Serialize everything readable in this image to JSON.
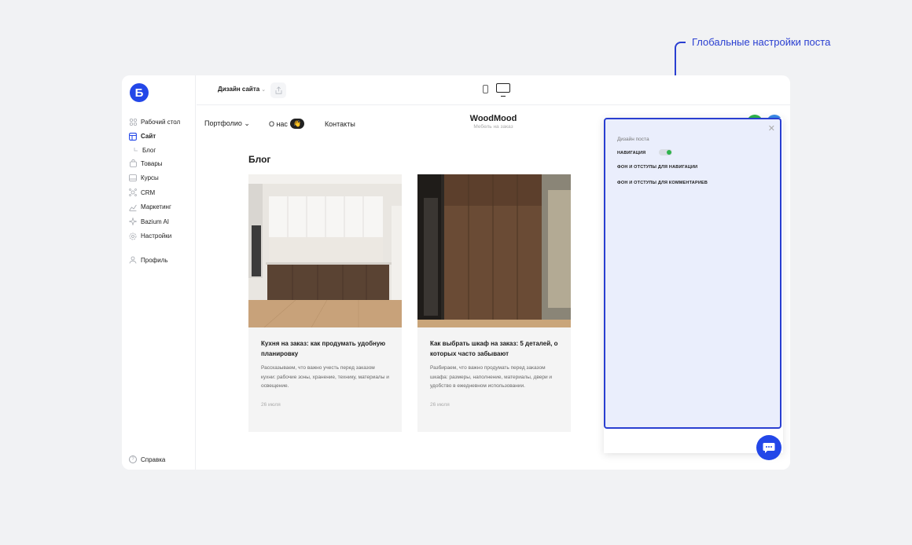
{
  "callout": {
    "text": "Глобальные настройки поста"
  },
  "sidebar": {
    "logo": "Б",
    "items": [
      {
        "label": "Рабочий стол",
        "icon": "dashboard-icon"
      },
      {
        "label": "Сайт",
        "icon": "site-icon",
        "active": true
      },
      {
        "label": "Блог",
        "icon": "sub-arrow-icon",
        "sub": true
      },
      {
        "label": "Товары",
        "icon": "bag-icon"
      },
      {
        "label": "Курсы",
        "icon": "courses-icon"
      },
      {
        "label": "CRM",
        "icon": "crm-icon"
      },
      {
        "label": "Маркетинг",
        "icon": "marketing-icon"
      },
      {
        "label": "Bazium AI",
        "icon": "ai-icon"
      },
      {
        "label": "Настройки",
        "icon": "settings-icon"
      }
    ],
    "profile": "Профиль",
    "help": "Справка"
  },
  "topbar": {
    "design": "Дизайн сайта"
  },
  "site": {
    "nav": {
      "portfolio": "Портфолио",
      "about": "О нас",
      "contacts": "Контакты",
      "wave": "👋"
    },
    "brand": {
      "name": "WoodMood",
      "subtitle": "Мебель на заказ"
    },
    "blog_title": "Блог",
    "posts": [
      {
        "title": "Кухня на заказ: как продумать удобную планировку",
        "desc": "Рассказываем, что важно учесть перед заказом кухни: рабочие зоны, хранение, технику, материалы и освещение.",
        "date": "26 июля"
      },
      {
        "title": "Как выбрать шкаф на заказ: 5 деталей, о которых часто забывают",
        "desc": "Разбираем, что важно продумать перед заказом шкафа: размеры, наполнение, материалы, двери и удобство в ежедневном использовании.",
        "date": "26 июля"
      }
    ]
  },
  "panel": {
    "title": "Дизайн поста",
    "nav_label": "НАВИГАЦИЯ",
    "nav_toggle_on": true,
    "bg_nav": "ФОН И ОТСТУПЫ ДЛЯ НАВИГАЦИИ",
    "bg_comments": "ФОН И ОТСТУПЫ ДЛЯ КОММЕНТАРИЕВ"
  },
  "colors": {
    "accent": "#2347e8",
    "callout": "#2a3fd1",
    "toggle_on": "#2eb34c",
    "panel_bg": "#eaeefc"
  }
}
